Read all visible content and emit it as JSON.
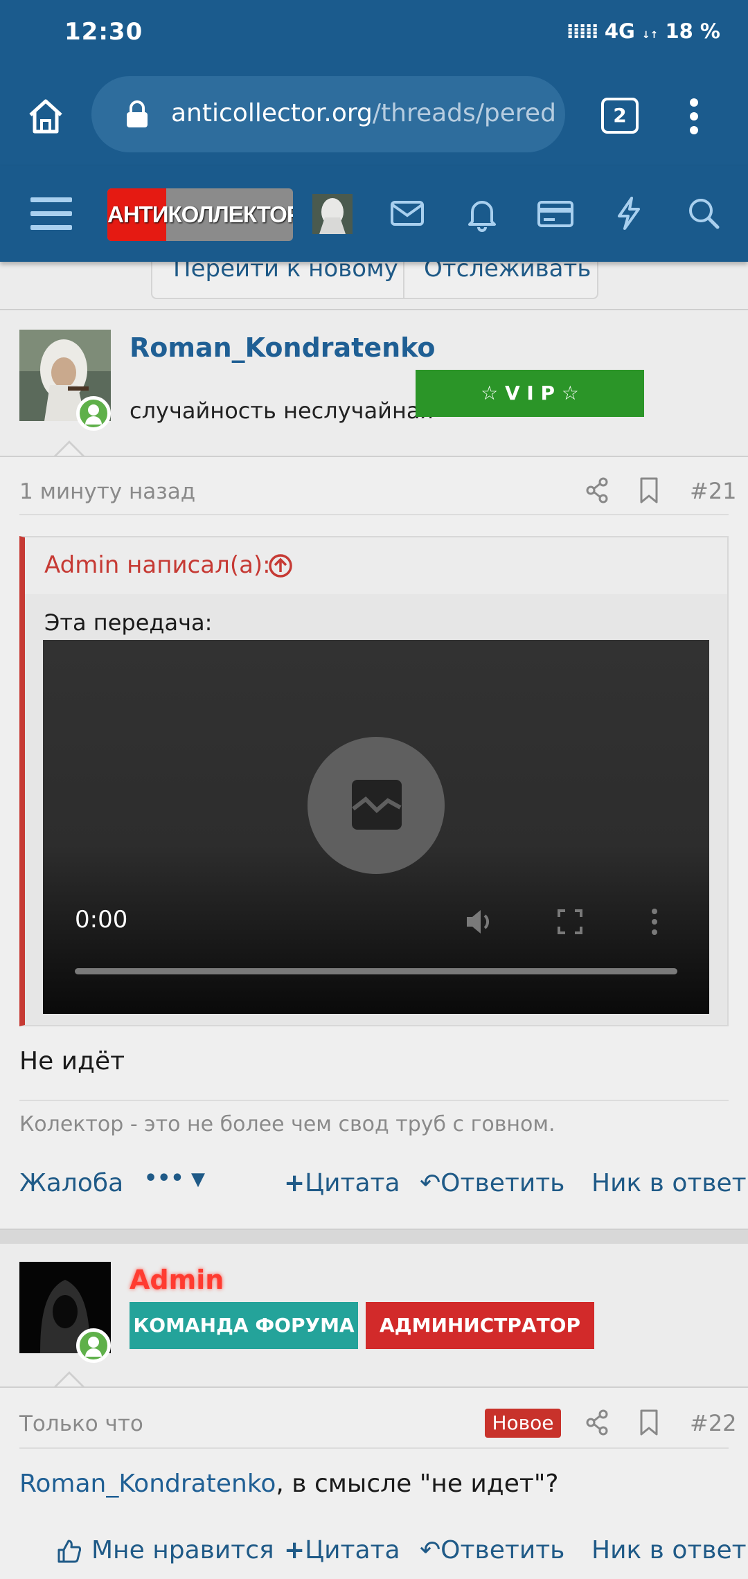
{
  "status_bar": {
    "time": "12:30",
    "signal": "4G",
    "battery": "18 %"
  },
  "browser": {
    "url_host": "anticollector.org",
    "url_path": "/threads/pereda",
    "tab_count": "2"
  },
  "forum_header": {
    "logo_text": "АНТИКОЛЛЕКТОР"
  },
  "thread_buttons": {
    "go_new": "Перейти к новому",
    "watch": "Отслеживать"
  },
  "posts": [
    {
      "author": "Roman_Kondratenko",
      "user_title": "случайность неслучайная",
      "badge": "☆ V I P ☆",
      "time": "1 минуту назад",
      "number": "#21",
      "quote": {
        "author_line": "Admin написал(а):",
        "text": "Эта передача:",
        "video_time": "0:00"
      },
      "body": "Не идёт",
      "signature": "Колектор - это не более чем свод труб с говном.",
      "actions": {
        "report": "Жалоба",
        "more": "•••",
        "quote": "Цитата",
        "reply": "Ответить",
        "nick": "Ник в ответ"
      }
    },
    {
      "author": "Admin",
      "badges": [
        "КОМАНДА ФОРУМА",
        "АДМИНИСТРАТОР"
      ],
      "time": "Только что",
      "new_label": "Новое",
      "number": "#22",
      "body_link": "Roman_Kondratenko",
      "body_rest": ", в смысле \"не идет\"?",
      "actions": {
        "like": "Мне нравится",
        "quote": "Цитата",
        "reply": "Ответить",
        "nick": "Ник в ответ"
      }
    }
  ],
  "colors": {
    "header": "#1b5b8d",
    "link": "#1f5f94",
    "vip": "#2b9528",
    "team": "#24a39a",
    "admin": "#d22a2a",
    "quote_border": "#c63a34"
  }
}
